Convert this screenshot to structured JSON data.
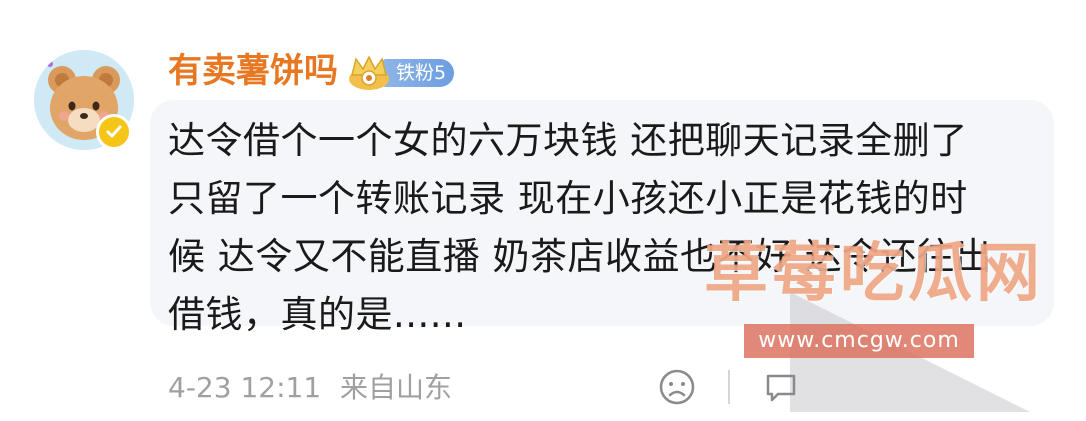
{
  "user": {
    "name": "有卖薯饼吗",
    "fan_badge": "铁粉5"
  },
  "comment": {
    "lines": [
      "达令借个一个女的六万块钱 还把聊天记录全删了",
      "只留了一个转账记录 现在小孩还小正是花钱的时",
      "候 达令又不能直播 奶茶店收益也不好 达令还往出",
      "借钱，真的是......"
    ]
  },
  "meta": {
    "time": "4-23 12:11",
    "source": "来自山东"
  },
  "watermark": {
    "text": "草莓吃瓜网",
    "url": "www.cmcgw.com"
  },
  "icons": {
    "avatar": "bear-avatar-icon",
    "verified": "verified-icon",
    "crown": "crown-icon",
    "emoji": "face-emoji-icon",
    "comment": "comment-icon"
  },
  "colors": {
    "username": "#e87722",
    "bubble": "#f5f6f9",
    "meta": "#a0a0a0",
    "badge": "#7aa7e4"
  }
}
